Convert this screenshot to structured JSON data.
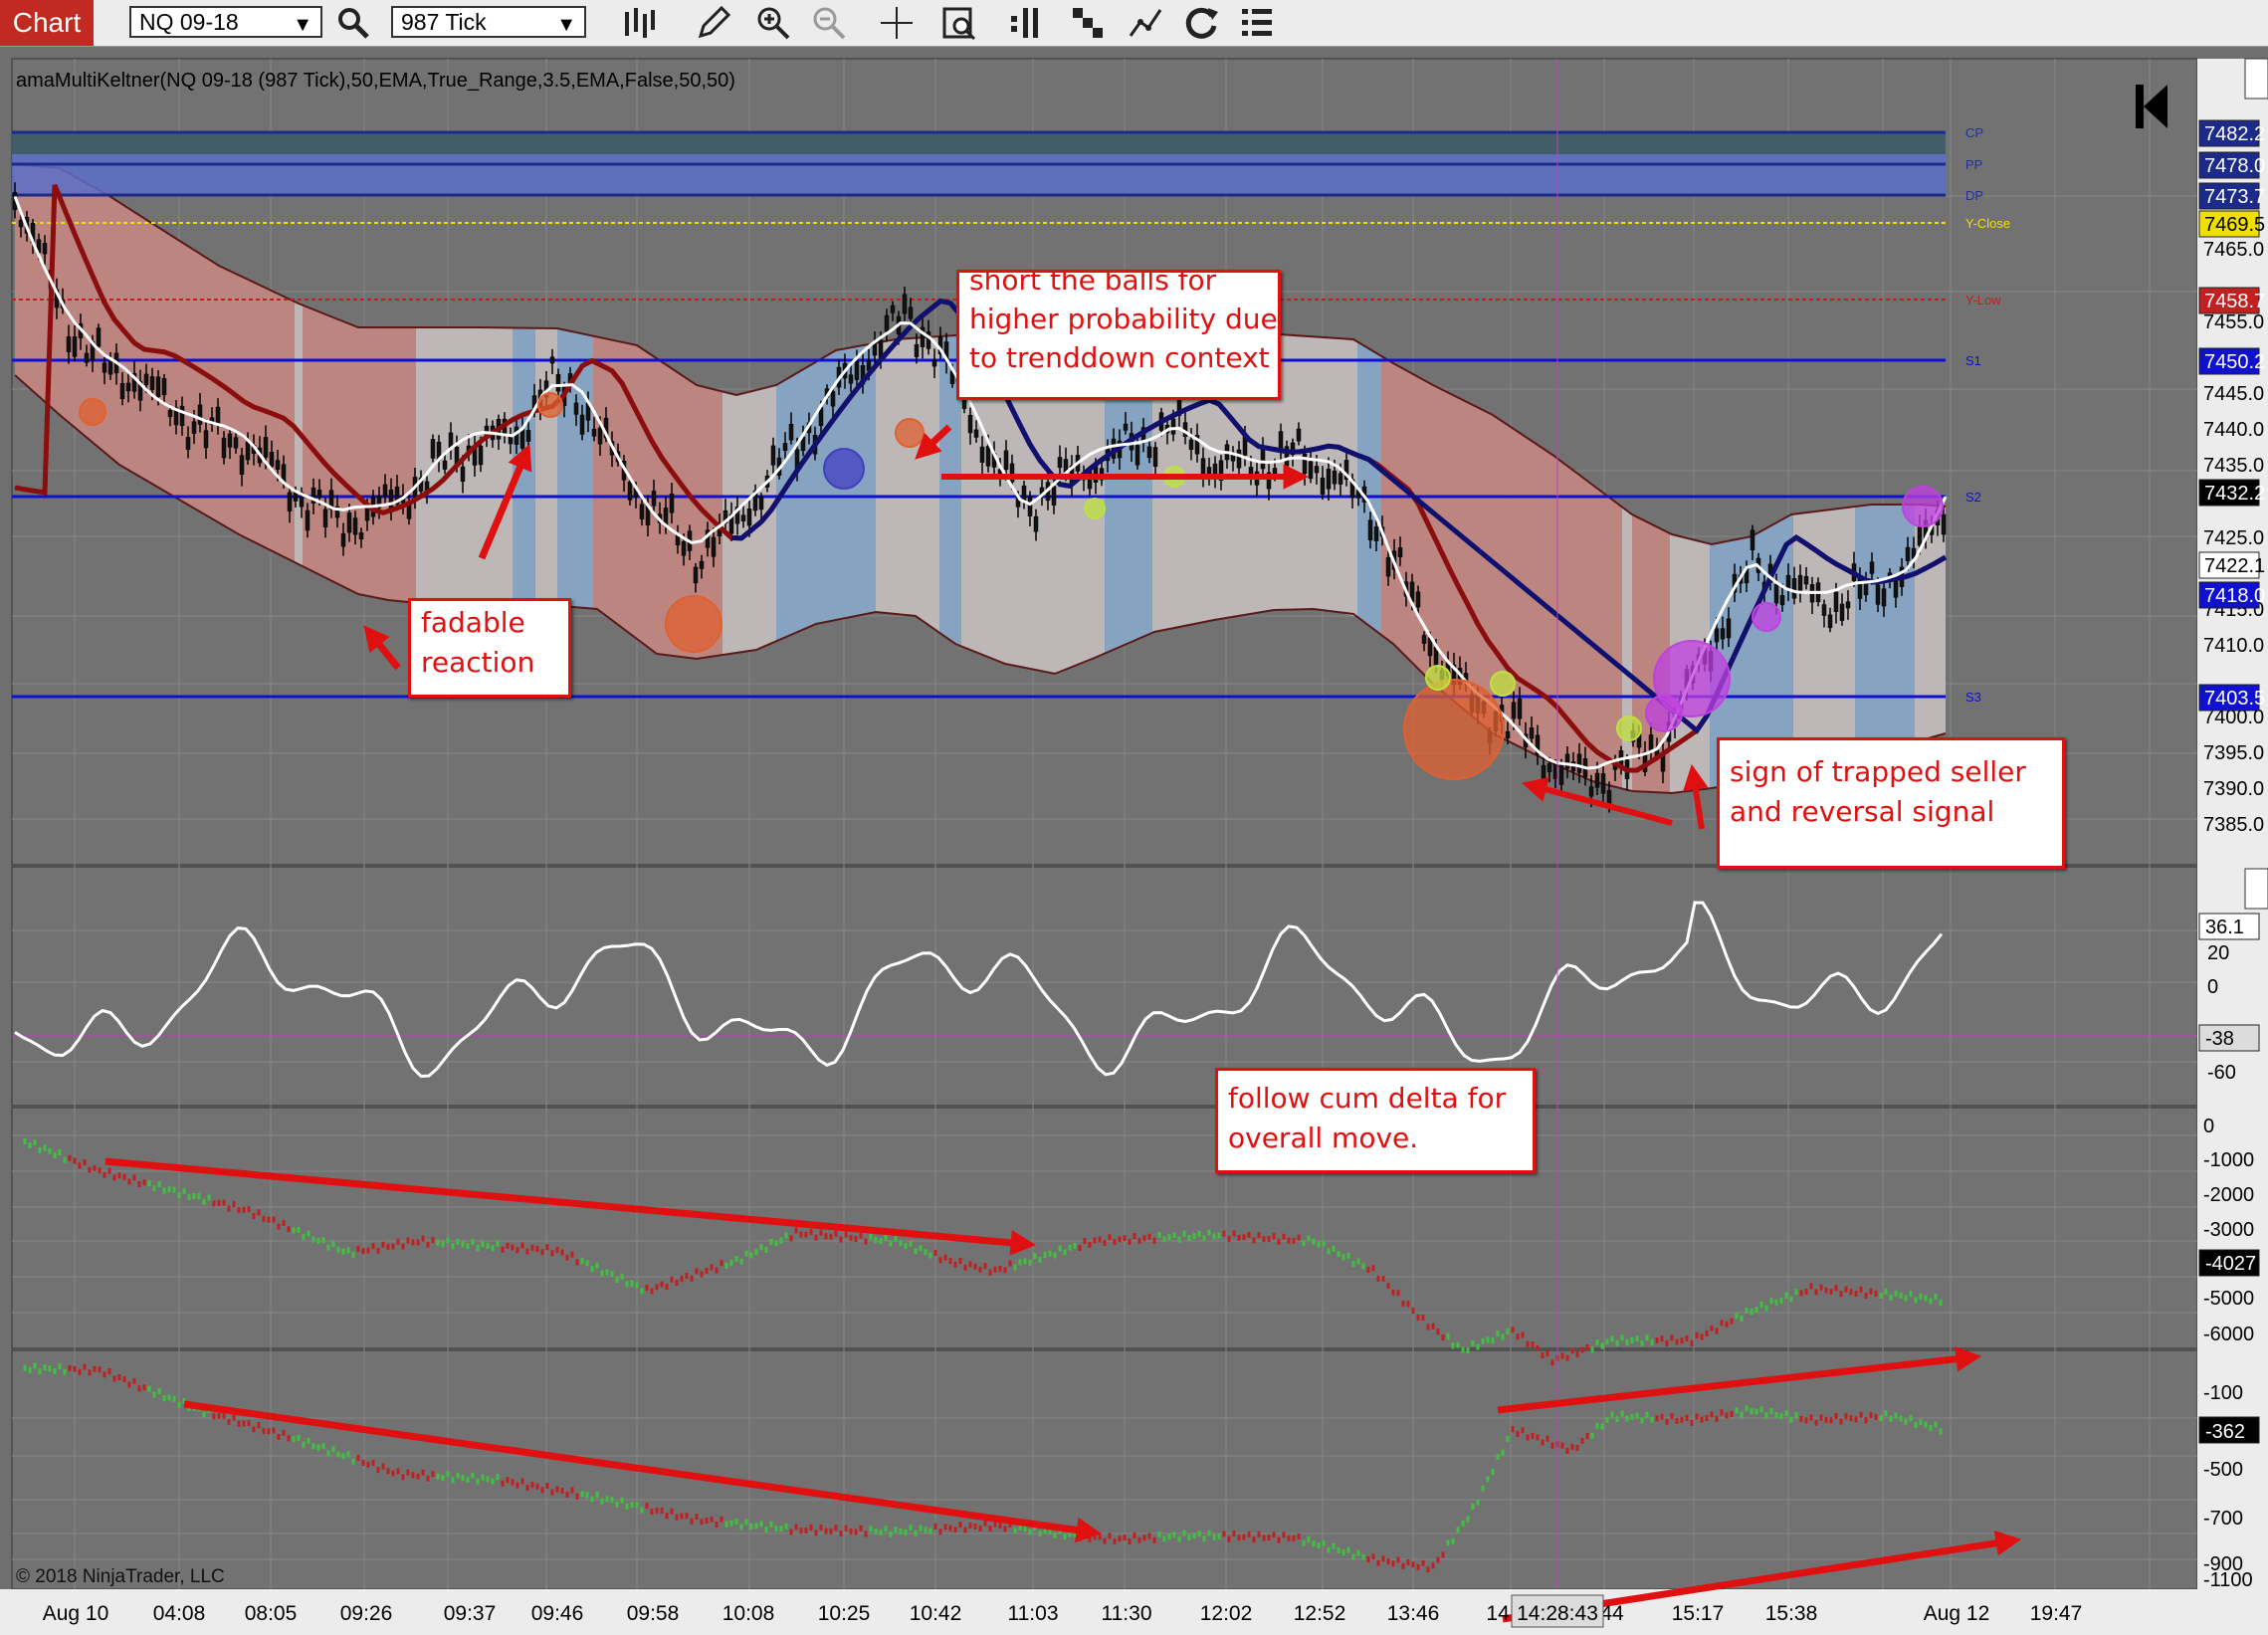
{
  "toolbar": {
    "chart_tab": "Chart",
    "instrument": "NQ 09-18",
    "interval": "987 Tick"
  },
  "indicator_label": "amaMultiKeltner(NQ 09-18 (987 Tick),50,EMA,True_Range,3.5,EMA,False,50,50)",
  "copyright": "© 2018 NinjaTrader, LLC",
  "cursor_time": "14:28:43",
  "levels": {
    "cp": "CP",
    "pp": "PP",
    "dp": "DP",
    "y_close": "Y-Close",
    "y_low": "Y-Low",
    "s1": "S1",
    "s2": "S2",
    "s3": "S3"
  },
  "price_axis": {
    "ticks": [
      "7465.0",
      "7455.0",
      "7445.0",
      "7440.0",
      "7435.0",
      "7425.0",
      "7415.0",
      "7410.0",
      "7400.0",
      "7395.0",
      "7390.0",
      "7385.0"
    ],
    "tags": [
      "7482.2",
      "7478.0",
      "7473.7",
      "7469.5",
      "7458.7",
      "7450.2",
      "7432.2",
      "7422.1",
      "7418.0",
      "7403.5"
    ],
    "colors": {
      "cp": "#1c2a8a",
      "y_close": "#f0e000",
      "y_low": "#c02020",
      "s_level": "#1010d0",
      "last": "#000000",
      "white": "#ffffff"
    }
  },
  "osc_axis": {
    "ticks": [
      "20",
      "0",
      "-60"
    ],
    "tags": [
      "36.1",
      "-38"
    ]
  },
  "delta1_axis": {
    "ticks": [
      "0",
      "-1000",
      "-2000",
      "-3000",
      "-5000",
      "-6000"
    ],
    "tag": "-4027"
  },
  "delta2_axis": {
    "ticks": [
      "-100",
      "-500",
      "-700",
      "-900",
      "-1100"
    ],
    "tag": "-362"
  },
  "time_axis": [
    "Aug 10",
    "04:08",
    "08:05",
    "09:26",
    "09:37",
    "09:46",
    "09:58",
    "10:08",
    "10:25",
    "10:42",
    "11:03",
    "11:30",
    "12:02",
    "12:52",
    "13:46",
    "14:",
    "44",
    "15:17",
    "15:38",
    "Aug 12",
    "19:47"
  ],
  "notes": {
    "fadable": [
      "fadable",
      "reaction"
    ],
    "short": [
      "short the balls for",
      "higher probability due",
      "to trenddown context"
    ],
    "trapped": [
      "sign of trapped seller",
      "and reversal signal"
    ],
    "cum_delta": [
      "follow cum delta for",
      "overall move."
    ]
  },
  "icons": [
    "search-icon",
    "bar-type-icon",
    "draw-pencil-icon",
    "zoom-in-icon",
    "zoom-out-icon",
    "crosshair-icon",
    "data-box-icon",
    "strategies-icon",
    "indicators-icon",
    "chart-trader-icon",
    "refresh-icon",
    "properties-icon"
  ]
}
